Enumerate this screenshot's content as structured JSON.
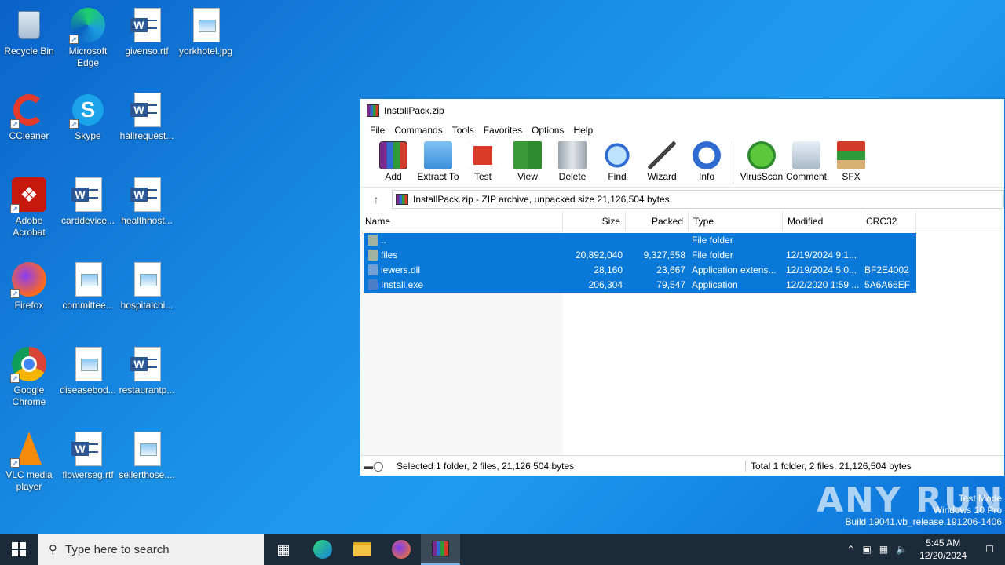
{
  "desktop": {
    "icons": [
      {
        "label": "Recycle Bin",
        "icon": "recycle-bin-icon"
      },
      {
        "label": "Microsoft Edge",
        "icon": "edge-icon"
      },
      {
        "label": "givenso.rtf",
        "icon": "word-document-icon"
      },
      {
        "label": "yorkhotel.jpg",
        "icon": "image-file-icon"
      },
      {
        "label": "CCleaner",
        "icon": "ccleaner-icon"
      },
      {
        "label": "Skype",
        "icon": "skype-icon"
      },
      {
        "label": "hallrequest...",
        "icon": "word-document-icon"
      },
      {
        "label": "Adobe Acrobat",
        "icon": "acrobat-icon"
      },
      {
        "label": "carddevice...",
        "icon": "word-document-icon"
      },
      {
        "label": "healthhost...",
        "icon": "word-document-icon"
      },
      {
        "label": "Firefox",
        "icon": "firefox-icon"
      },
      {
        "label": "committee...",
        "icon": "image-file-icon"
      },
      {
        "label": "hospitalchi...",
        "icon": "image-file-icon"
      },
      {
        "label": "Google Chrome",
        "icon": "chrome-icon"
      },
      {
        "label": "diseasebod...",
        "icon": "image-file-icon"
      },
      {
        "label": "restaurantp...",
        "icon": "word-document-icon"
      },
      {
        "label": "VLC media player",
        "icon": "vlc-icon"
      },
      {
        "label": "flowerseg.rtf",
        "icon": "word-document-icon"
      },
      {
        "label": "sellerthose....",
        "icon": "image-file-icon"
      }
    ]
  },
  "window": {
    "title": "InstallPack.zip",
    "menu": [
      "File",
      "Commands",
      "Tools",
      "Favorites",
      "Options",
      "Help"
    ],
    "toolbar": [
      {
        "label": "Add",
        "icon": "add-archive-icon"
      },
      {
        "label": "Extract To",
        "icon": "extract-folder-icon"
      },
      {
        "label": "Test",
        "icon": "test-clipboard-icon"
      },
      {
        "label": "View",
        "icon": "view-book-icon"
      },
      {
        "label": "Delete",
        "icon": "trash-icon"
      },
      {
        "label": "Find",
        "icon": "magnifier-icon"
      },
      {
        "label": "Wizard",
        "icon": "wand-icon"
      },
      {
        "label": "Info",
        "icon": "info-icon"
      },
      {
        "label": "VirusScan",
        "icon": "bug-scan-icon"
      },
      {
        "label": "Comment",
        "icon": "comment-icon"
      },
      {
        "label": "SFX",
        "icon": "sfx-box-icon"
      }
    ],
    "address": "InstallPack.zip - ZIP archive, unpacked size 21,126,504 bytes",
    "columns": [
      "Name",
      "Size",
      "Packed",
      "Type",
      "Modified",
      "CRC32"
    ],
    "rows": [
      {
        "name": "..",
        "size": "",
        "packed": "",
        "type": "File folder",
        "modified": "",
        "crc": ""
      },
      {
        "name": "files",
        "size": "20,892,040",
        "packed": "9,327,558",
        "type": "File folder",
        "modified": "12/19/2024 9:1...",
        "crc": ""
      },
      {
        "name": "iewers.dll",
        "size": "28,160",
        "packed": "23,667",
        "type": "Application extens...",
        "modified": "12/19/2024 5:0...",
        "crc": "BF2E4002"
      },
      {
        "name": "Install.exe",
        "size": "206,304",
        "packed": "79,547",
        "type": "Application",
        "modified": "12/2/2020 1:59 ...",
        "crc": "5A6A66EF"
      }
    ],
    "status_left": "Selected 1 folder, 2 files, 21,126,504 bytes",
    "status_right": "Total 1 folder, 2 files, 21,126,504 bytes"
  },
  "watermark": {
    "logo": "ANY RUN",
    "line1": "Test Mode",
    "line2": "Windows 10 Pro",
    "line3": "Build 19041.vb_release.191206-1406"
  },
  "taskbar": {
    "search_placeholder": "Type here to search",
    "time": "5:45 AM",
    "date": "12/20/2024"
  }
}
